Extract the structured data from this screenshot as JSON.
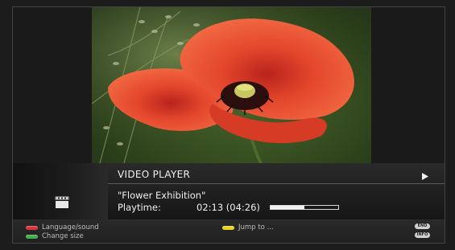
{
  "player": {
    "title": "VIDEO PLAYER",
    "media_name": "\"Flower Exhibition\"",
    "playtime_label": "Playtime:",
    "playtime_value": "02:13 (04:26)",
    "progress_fraction": 0.5
  },
  "icons": {
    "media_type": "clapperboard-icon",
    "play_state": "play-icon"
  },
  "hints": {
    "red_label": "Language/sound",
    "green_label": "Change size",
    "yellow_label": "Jump to ...",
    "end_key": "END",
    "info_key": "INFO"
  },
  "colors": {
    "red_key": "#d8343a",
    "green_key": "#3cb04a",
    "yellow_key": "#e8d21e",
    "poppy": "#e8452b"
  }
}
